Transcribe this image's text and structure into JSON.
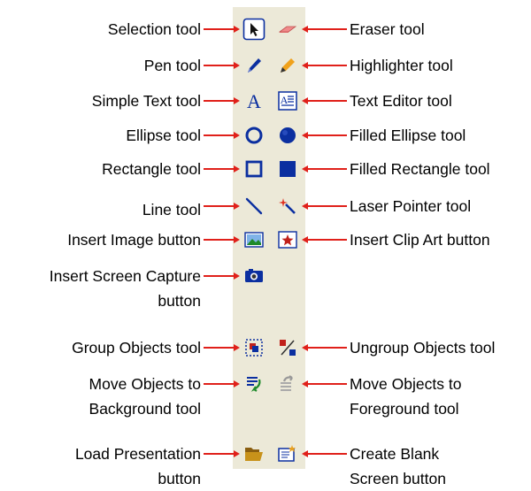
{
  "tools": [
    {
      "key": "selection",
      "label": "Selection tool",
      "icon": "selection-arrow-icon",
      "side": "left"
    },
    {
      "key": "eraser",
      "label": "Eraser tool",
      "icon": "eraser-icon",
      "side": "right"
    },
    {
      "key": "pen",
      "label": "Pen tool",
      "icon": "pen-icon",
      "side": "left"
    },
    {
      "key": "highlighter",
      "label": "Highlighter tool",
      "icon": "highlighter-icon",
      "side": "right"
    },
    {
      "key": "simple-text",
      "label": "Simple Text tool",
      "icon": "letter-a-icon",
      "side": "left"
    },
    {
      "key": "text-editor",
      "label": "Text Editor tool",
      "icon": "text-editor-icon",
      "side": "right"
    },
    {
      "key": "ellipse",
      "label": "Ellipse tool",
      "icon": "ellipse-icon",
      "side": "left"
    },
    {
      "key": "filled-ellipse",
      "label": "Filled Ellipse tool",
      "icon": "filled-ellipse-icon",
      "side": "right"
    },
    {
      "key": "rectangle",
      "label": "Rectangle tool",
      "icon": "rectangle-icon",
      "side": "left"
    },
    {
      "key": "filled-rectangle",
      "label": "Filled Rectangle tool",
      "icon": "filled-rectangle-icon",
      "side": "right"
    },
    {
      "key": "line",
      "label": "Line tool",
      "icon": "line-icon",
      "side": "left"
    },
    {
      "key": "laser-pointer",
      "label": "Laser Pointer tool",
      "icon": "laser-pointer-icon",
      "side": "right"
    },
    {
      "key": "insert-image",
      "label": "Insert Image button",
      "icon": "insert-image-icon",
      "side": "left"
    },
    {
      "key": "insert-clip-art",
      "label": "Insert Clip Art button",
      "icon": "clip-art-icon",
      "side": "right"
    },
    {
      "key": "insert-screen-capture",
      "label": [
        "Insert Screen Capture",
        "button"
      ],
      "icon": "camera-icon",
      "side": "left"
    },
    {
      "key": "group-objects",
      "label": "Group Objects tool",
      "icon": "group-objects-icon",
      "side": "left"
    },
    {
      "key": "ungroup-objects",
      "label": "Ungroup Objects tool",
      "icon": "ungroup-objects-icon",
      "side": "right"
    },
    {
      "key": "move-to-background",
      "label": [
        "Move Objects to",
        "Background tool"
      ],
      "icon": "move-background-icon",
      "side": "left"
    },
    {
      "key": "move-to-foreground",
      "label": [
        "Move Objects to",
        "Foreground tool"
      ],
      "icon": "move-foreground-icon",
      "side": "right"
    },
    {
      "key": "load-presentation",
      "label": [
        "Load Presentation",
        "button"
      ],
      "icon": "folder-open-icon",
      "side": "left"
    },
    {
      "key": "create-blank-screen",
      "label": [
        "Create Blank",
        "Screen button"
      ],
      "icon": "blank-screen-icon",
      "side": "right"
    }
  ],
  "colors": {
    "connector": "#e0201a",
    "toolbar_bg": "#ece9d8",
    "icon_blue": "#0b2fa0",
    "icon_dark": "#0a2a78",
    "highlight_orange": "#f0a21c",
    "eraser_pink": "#f08a8a",
    "folder": "#c8921a",
    "green": "#1e8a2a"
  }
}
